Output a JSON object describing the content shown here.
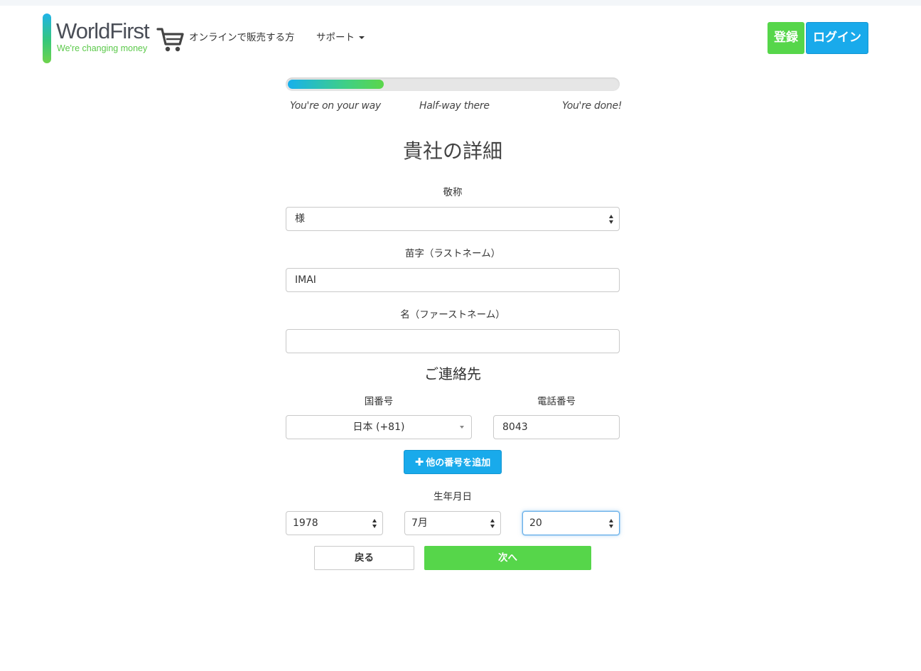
{
  "header": {
    "logo_name": "WorldFirst",
    "logo_tagline": "We're changing money",
    "nav_online_sellers": "オンラインで販売する方",
    "nav_support": "サポート",
    "register_button": "登録",
    "login_button": "ログイン"
  },
  "progress": {
    "fraction": 0.29,
    "labels": [
      "You're on your way",
      "Half-way there",
      "You're done!"
    ]
  },
  "form": {
    "title": "貴社の詳細",
    "salutation": {
      "label": "敬称",
      "value": "様"
    },
    "last_name": {
      "label": "苗字（ラストネーム）",
      "value": "IMAI"
    },
    "first_name": {
      "label": "名（ファーストネーム）",
      "value": ""
    },
    "contact_title": "ご連絡先",
    "country_code": {
      "label": "国番号",
      "value": "日本 (+81)"
    },
    "phone": {
      "label": "電話番号",
      "value": "8043"
    },
    "add_number_button": "他の番号を追加",
    "dob": {
      "label": "生年月日",
      "year": "1978",
      "month": "7月",
      "day": "20"
    },
    "back_button": "戻る",
    "next_button": "次へ"
  },
  "colors": {
    "green": "#56d64a",
    "blue": "#19aaeb"
  }
}
